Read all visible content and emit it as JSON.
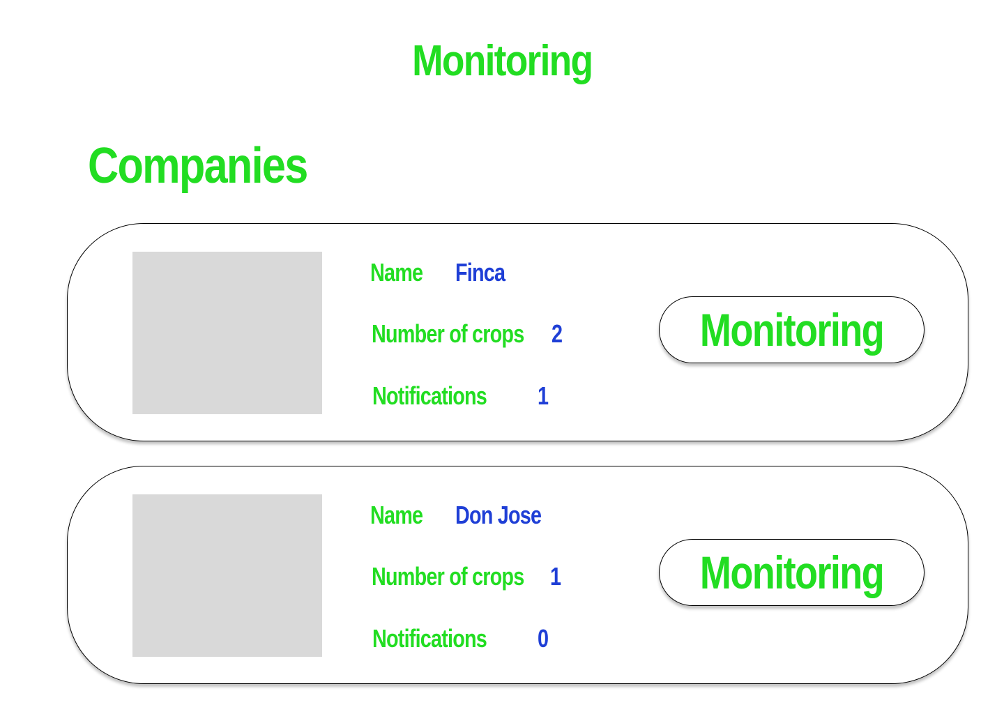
{
  "colors": {
    "heading_green": "#22dd22",
    "value_blue": "#1f3fd6",
    "image_placeholder": "#d9d9d9",
    "border": "#000000"
  },
  "header": {
    "title": "Monitoring"
  },
  "section": {
    "title": "Companies"
  },
  "companies": [
    {
      "name_label": "Name",
      "name_value": "Finca",
      "crops_label": "Number of crops",
      "crops_value": "2",
      "notifications_label": "Notifications",
      "notifications_value": "1",
      "button_label": "Monitoring"
    },
    {
      "name_label": "Name",
      "name_value": "Don Jose",
      "crops_label": "Number of crops",
      "crops_value": "1",
      "notifications_label": "Notifications",
      "notifications_value": "0",
      "button_label": "Monitoring"
    }
  ]
}
